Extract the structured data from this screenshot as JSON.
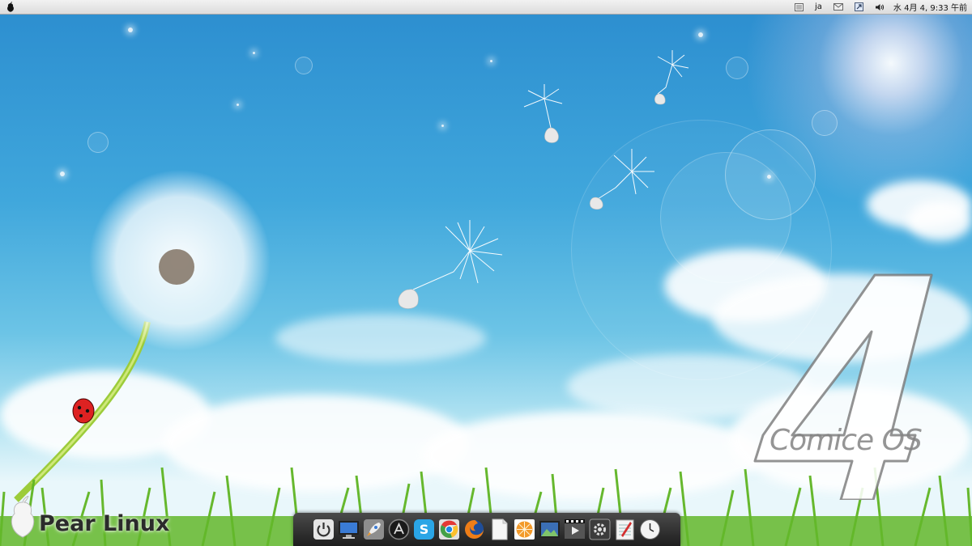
{
  "menubar": {
    "apple_menu_icon": "pear-icon",
    "tray": {
      "input_method": "ja",
      "clock": "水 4月 4, 9:33 午前",
      "icons": [
        "keyboard-icon",
        "mail-icon",
        "network-icon",
        "volume-icon"
      ]
    }
  },
  "desktop": {
    "logo_text": "Pear Linux",
    "watermark_number": "4",
    "watermark_text": "Comice OS"
  },
  "dock": {
    "items": [
      {
        "name": "power-icon",
        "color": "#cfcfcf"
      },
      {
        "name": "monitor-icon",
        "color": "#3a7bd5"
      },
      {
        "name": "rocket-launcher-icon",
        "color": "#bdbdbd"
      },
      {
        "name": "app-store-icon",
        "color": "#222222"
      },
      {
        "name": "skype-icon",
        "color": "#2aa5e6"
      },
      {
        "name": "chrome-icon",
        "color": "#e53935"
      },
      {
        "name": "firefox-icon",
        "color": "#ef7d16"
      },
      {
        "name": "document-icon",
        "color": "#f4f4f4"
      },
      {
        "name": "orange-photo-icon",
        "color": "#f39a2b"
      },
      {
        "name": "image-viewer-icon",
        "color": "#3b6fb6"
      },
      {
        "name": "video-player-icon",
        "color": "#555555"
      },
      {
        "name": "system-settings-icon",
        "color": "#444444"
      },
      {
        "name": "text-editor-icon",
        "color": "#eeeeee"
      },
      {
        "name": "clock-icon",
        "color": "#f2f2f2"
      }
    ]
  }
}
